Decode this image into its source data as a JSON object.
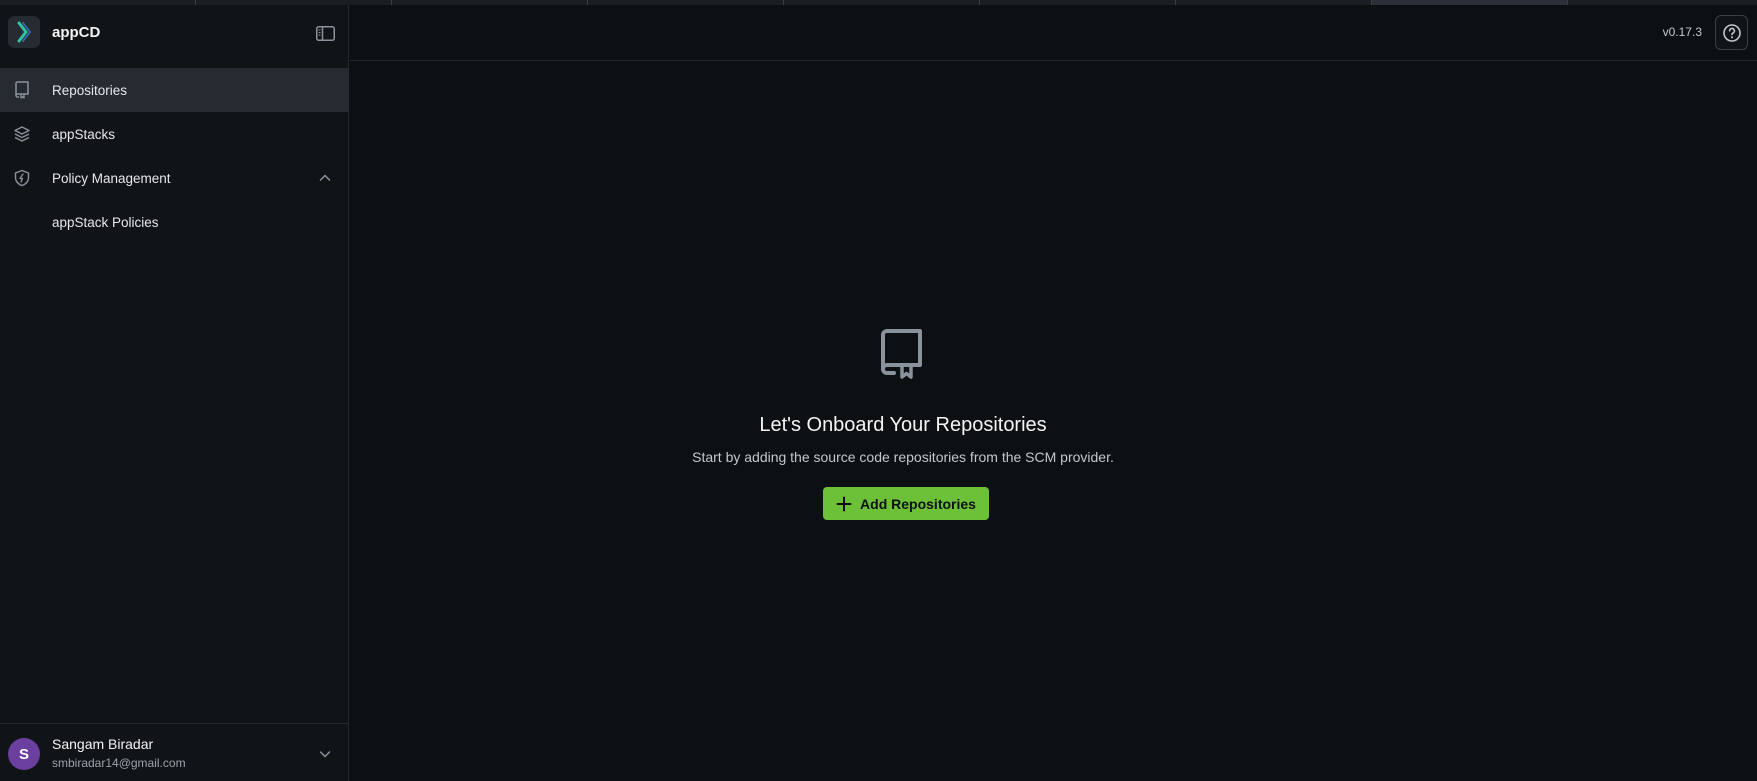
{
  "app": {
    "name": "appCD",
    "version": "v0.17.3"
  },
  "sidebar": {
    "items": [
      {
        "label": "Repositories",
        "icon": "repo-icon",
        "active": true
      },
      {
        "label": "appStacks",
        "icon": "layers-icon"
      },
      {
        "label": "Policy Management",
        "icon": "shield-icon",
        "expanded": true
      },
      {
        "label": "appStack Policies",
        "sub": true
      }
    ]
  },
  "user": {
    "initial": "S",
    "name": "Sangam Biradar",
    "email": "smbiradar14@gmail.com"
  },
  "empty_state": {
    "icon": "repo-icon",
    "title": "Let's Onboard Your Repositories",
    "subtitle": "Start by adding the source code repositories from the SCM provider.",
    "button_label": "Add Repositories"
  },
  "colors": {
    "accent": "#6cc138",
    "background": "#0d1013",
    "sidebar": "#111417",
    "avatar": "#6b3fa0"
  }
}
